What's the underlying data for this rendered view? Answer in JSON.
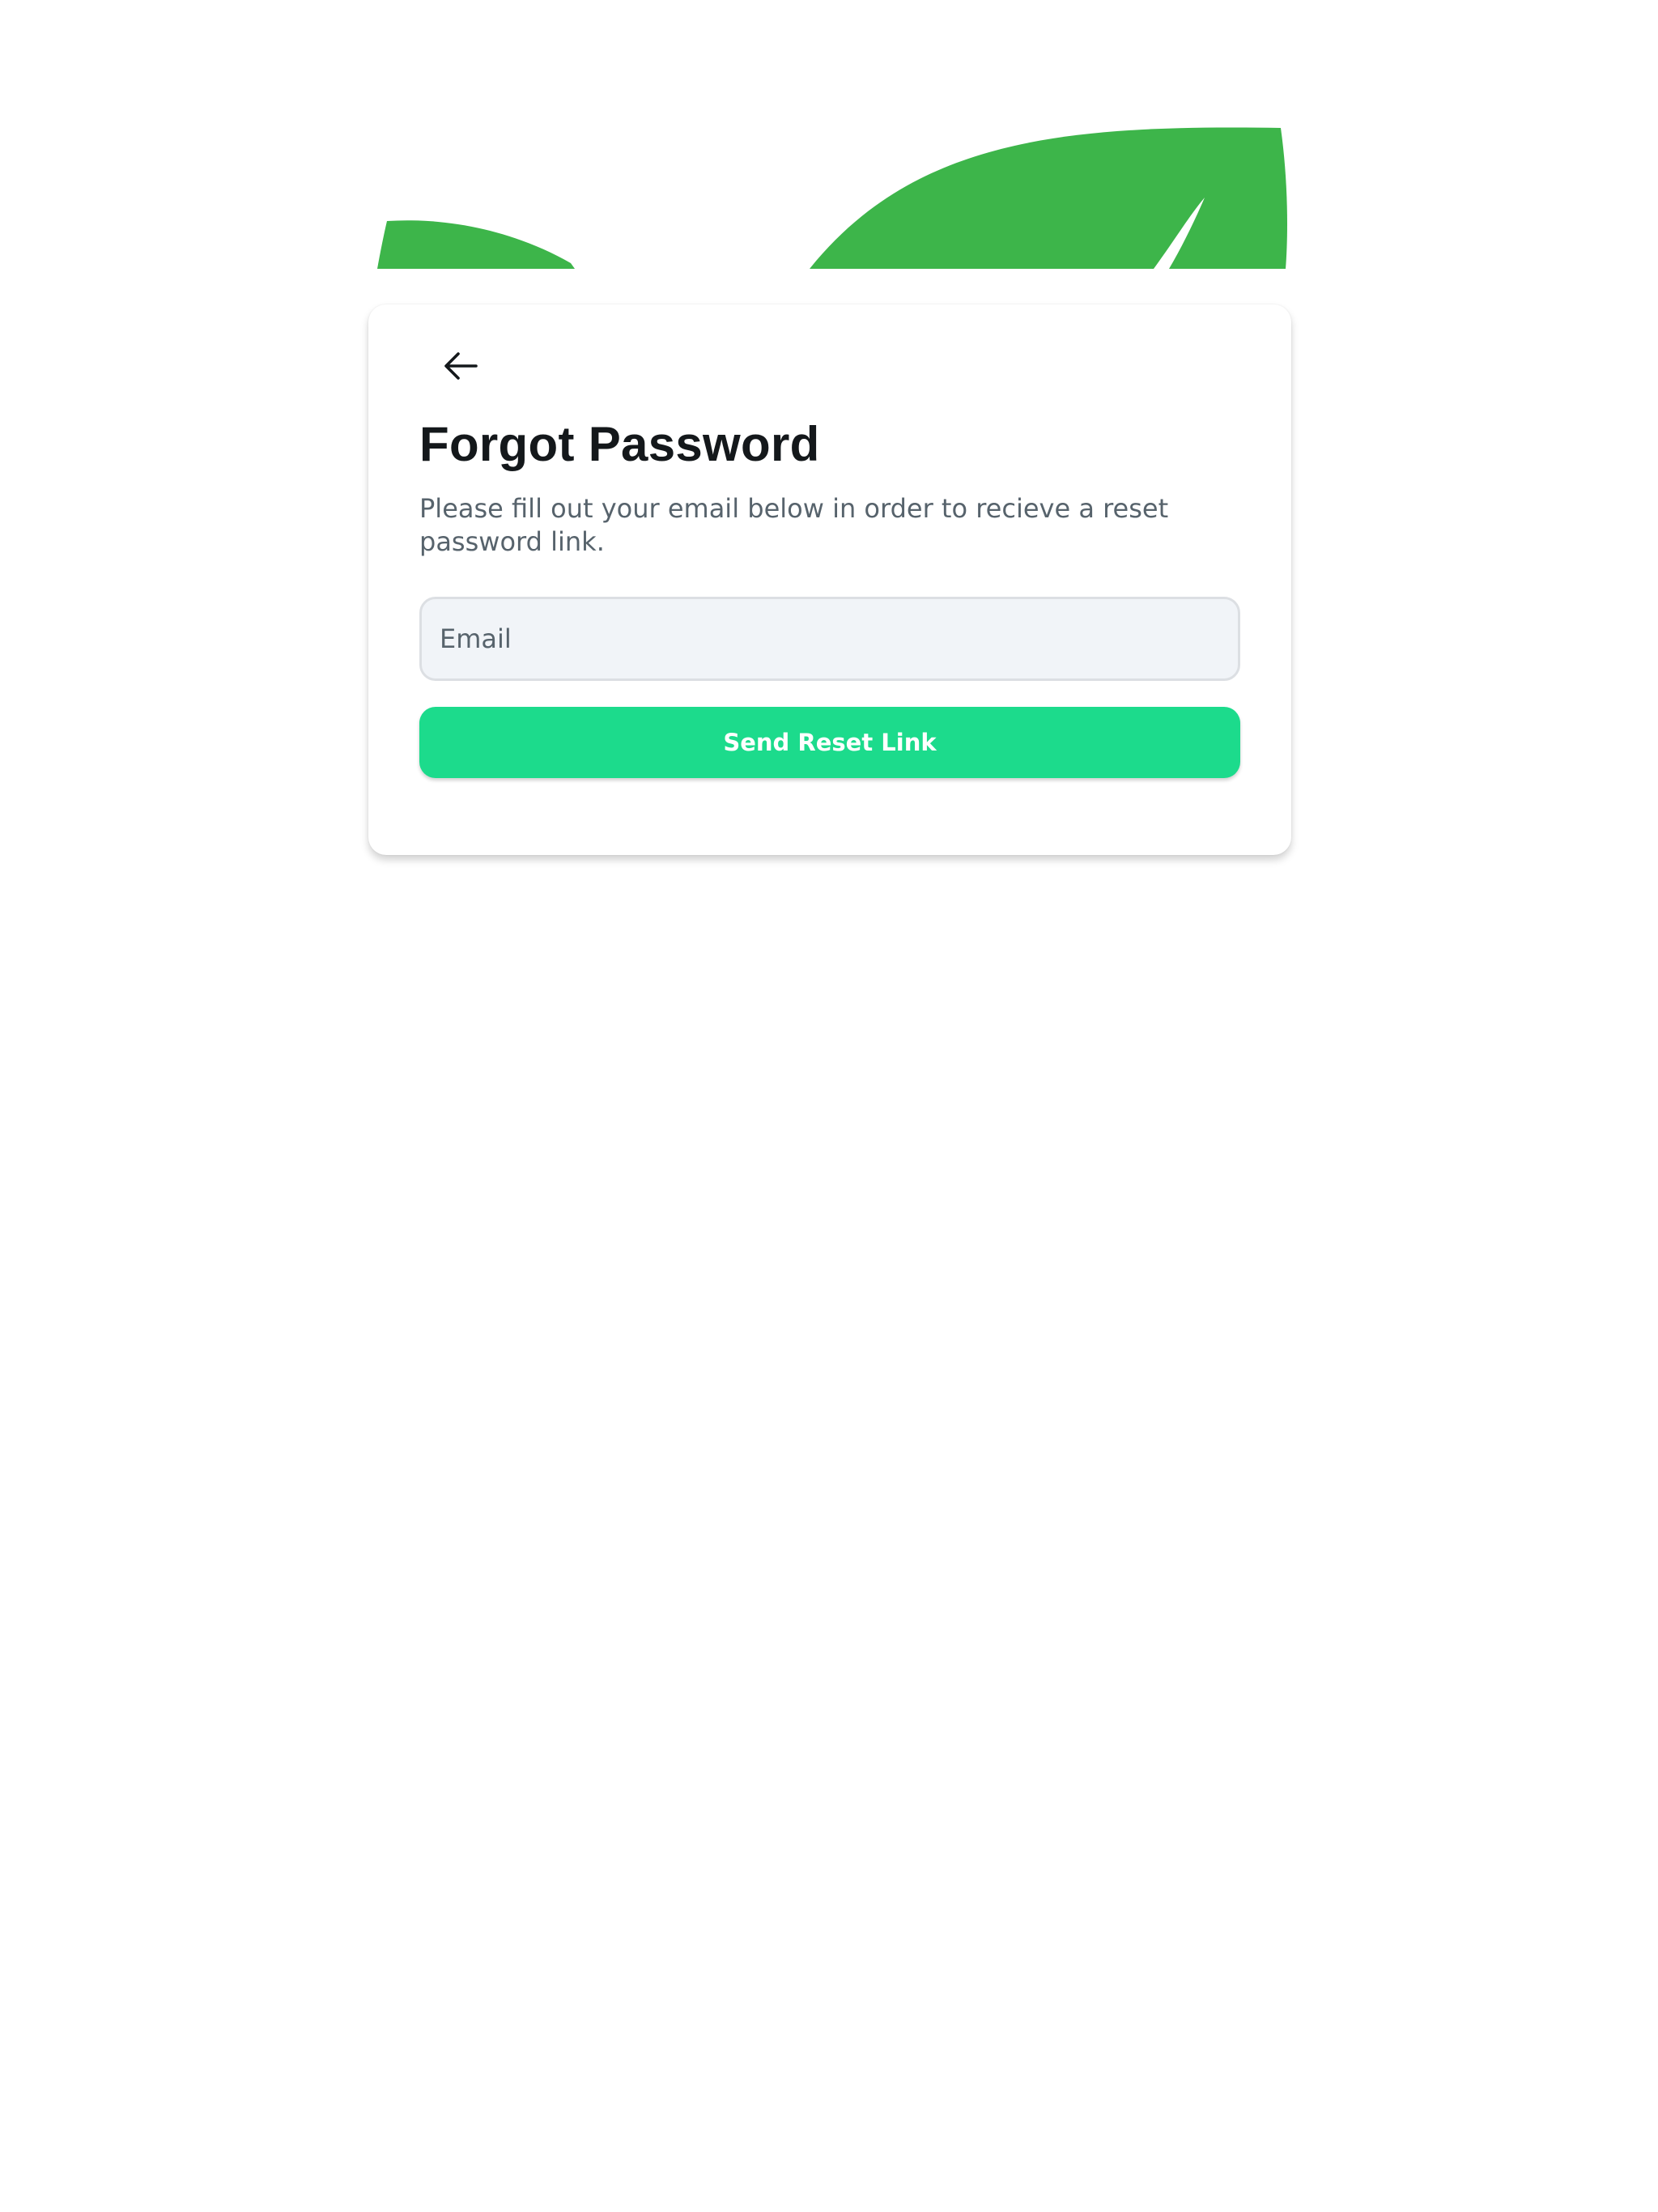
{
  "app": {
    "background_color": "#ffffff",
    "accent_color": "#1cdb8c",
    "leaf_color": "#3db54a"
  },
  "header_art": {
    "icon": "leaf-icon"
  },
  "card": {
    "back_icon": "arrow-left-icon",
    "title": "Forgot Password",
    "subtitle": "Please fill out your email below in order to recieve a reset password link.",
    "email": {
      "placeholder": "Email",
      "value": ""
    },
    "send_button_label": "Send Reset Link"
  }
}
